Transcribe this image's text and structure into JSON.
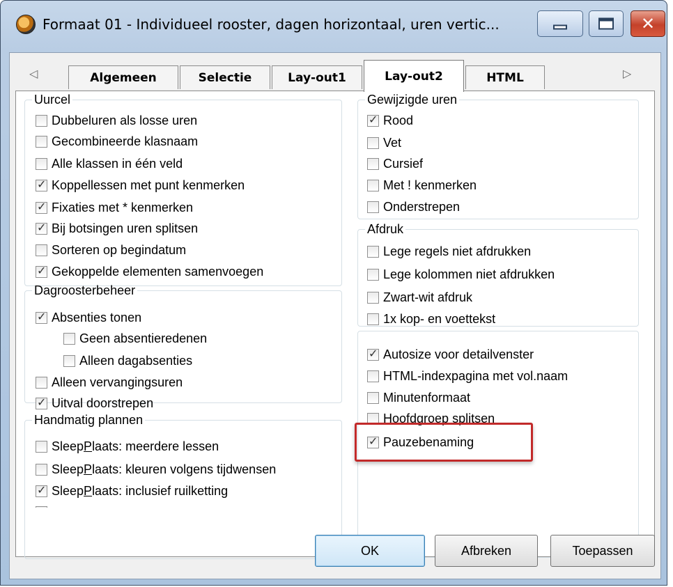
{
  "window": {
    "title": "Formaat 01 - Individueel rooster, dagen horizontaal, uren vertic...",
    "icon": "clock-app-icon",
    "controls": {
      "minimize": "minimize-icon",
      "maximize": "maximize-icon",
      "close": "✕"
    }
  },
  "tabs": {
    "scroll_left": "◁",
    "scroll_right": "▷",
    "items": [
      "Algemeen",
      "Selectie",
      "Lay-out1",
      "Lay-out2",
      "HTML"
    ],
    "active": "Lay-out2"
  },
  "groups": {
    "uurcel": {
      "legend": "Uurcel",
      "items": [
        {
          "label": "Dubbeluren als losse uren",
          "checked": false
        },
        {
          "label": "Gecombineerde klasnaam",
          "checked": false
        },
        {
          "label": "Alle klassen in één veld",
          "checked": false
        },
        {
          "label": "Koppellessen met punt kenmerken",
          "checked": true
        },
        {
          "label": "Fixaties met * kenmerken",
          "checked": true
        },
        {
          "label": "Bij botsingen uren splitsen",
          "checked": true
        },
        {
          "label": "Sorteren op begindatum",
          "checked": false
        },
        {
          "label": "Gekoppelde elementen samenvoegen",
          "checked": true
        }
      ]
    },
    "dagroosterbeheer": {
      "legend": "Dagroosterbeheer",
      "items": [
        {
          "label": "Absenties tonen",
          "checked": true
        },
        {
          "label": "Geen absentieredenen",
          "checked": false
        },
        {
          "label": "Alleen dagabsenties",
          "checked": false
        },
        {
          "label": "Alleen vervangingsuren",
          "checked": false
        },
        {
          "label": "Uitval doorstrepen",
          "checked": true
        }
      ]
    },
    "handmatig": {
      "legend": "Handmatig plannen",
      "items": [
        {
          "label_pre": "Sleep",
          "label_u": "P",
          "label_post": "laats: meerdere lessen",
          "checked": false
        },
        {
          "label_pre": "Sleep",
          "label_u": "P",
          "label_post": "laats: kleuren volgens tijdwensen",
          "checked": false
        },
        {
          "label_pre": "Sleep",
          "label_u": "P",
          "label_post": "laats: inclusief ruilketting",
          "checked": true
        }
      ]
    },
    "gewijzigde": {
      "legend": "Gewijzigde uren",
      "items": [
        {
          "label": "Rood",
          "checked": true
        },
        {
          "label": "Vet",
          "checked": false
        },
        {
          "label": "Cursief",
          "checked": false
        },
        {
          "label": "Met ! kenmerken",
          "checked": false
        },
        {
          "label": "Onderstrepen",
          "checked": false
        }
      ]
    },
    "afdruk": {
      "legend": "Afdruk",
      "items": [
        {
          "label": "Lege regels niet afdrukken",
          "checked": false
        },
        {
          "label": "Lege kolommen niet afdrukken",
          "checked": false
        },
        {
          "label": "Zwart-wit afdruk",
          "checked": false
        },
        {
          "label": "1x kop- en voettekst",
          "checked": false
        }
      ]
    },
    "overig": {
      "items": [
        {
          "label": "Autosize voor detailvenster",
          "checked": true
        },
        {
          "label": "HTML-indexpagina met vol.naam",
          "checked": false
        },
        {
          "label": "Minutenformaat",
          "checked": false
        },
        {
          "label": "Hoofdgroep splitsen",
          "checked": false
        },
        {
          "label": "Pauzebenaming",
          "checked": true
        }
      ]
    }
  },
  "buttons": {
    "ok": "OK",
    "cancel": "Afbreken",
    "apply": "Toepassen"
  },
  "colors": {
    "highlight": "#c22a2a",
    "ok_border": "#3c7fb1"
  }
}
